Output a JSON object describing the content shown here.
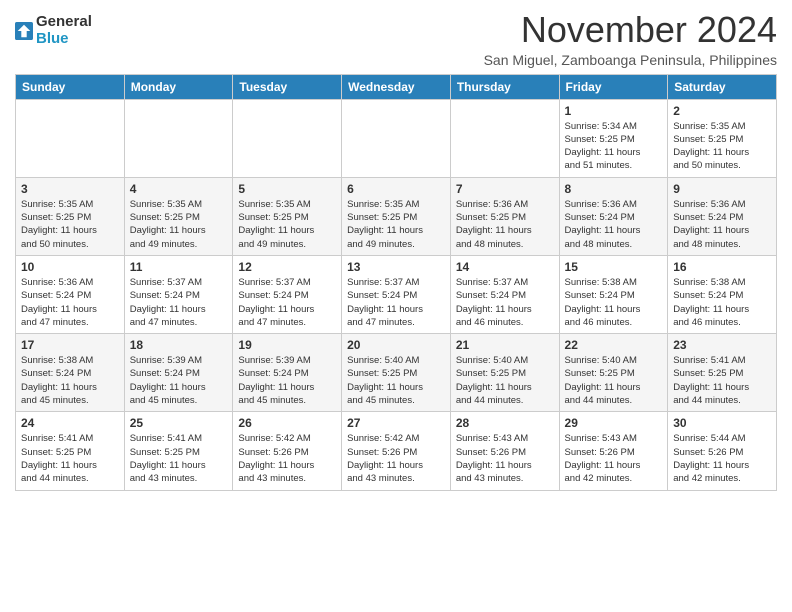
{
  "header": {
    "logo_line1": "General",
    "logo_line2": "Blue",
    "month_title": "November 2024",
    "location": "San Miguel, Zamboanga Peninsula, Philippines"
  },
  "weekdays": [
    "Sunday",
    "Monday",
    "Tuesday",
    "Wednesday",
    "Thursday",
    "Friday",
    "Saturday"
  ],
  "weeks": [
    [
      {
        "day": "",
        "info": ""
      },
      {
        "day": "",
        "info": ""
      },
      {
        "day": "",
        "info": ""
      },
      {
        "day": "",
        "info": ""
      },
      {
        "day": "",
        "info": ""
      },
      {
        "day": "1",
        "info": "Sunrise: 5:34 AM\nSunset: 5:25 PM\nDaylight: 11 hours\nand 51 minutes."
      },
      {
        "day": "2",
        "info": "Sunrise: 5:35 AM\nSunset: 5:25 PM\nDaylight: 11 hours\nand 50 minutes."
      }
    ],
    [
      {
        "day": "3",
        "info": "Sunrise: 5:35 AM\nSunset: 5:25 PM\nDaylight: 11 hours\nand 50 minutes."
      },
      {
        "day": "4",
        "info": "Sunrise: 5:35 AM\nSunset: 5:25 PM\nDaylight: 11 hours\nand 49 minutes."
      },
      {
        "day": "5",
        "info": "Sunrise: 5:35 AM\nSunset: 5:25 PM\nDaylight: 11 hours\nand 49 minutes."
      },
      {
        "day": "6",
        "info": "Sunrise: 5:35 AM\nSunset: 5:25 PM\nDaylight: 11 hours\nand 49 minutes."
      },
      {
        "day": "7",
        "info": "Sunrise: 5:36 AM\nSunset: 5:25 PM\nDaylight: 11 hours\nand 48 minutes."
      },
      {
        "day": "8",
        "info": "Sunrise: 5:36 AM\nSunset: 5:24 PM\nDaylight: 11 hours\nand 48 minutes."
      },
      {
        "day": "9",
        "info": "Sunrise: 5:36 AM\nSunset: 5:24 PM\nDaylight: 11 hours\nand 48 minutes."
      }
    ],
    [
      {
        "day": "10",
        "info": "Sunrise: 5:36 AM\nSunset: 5:24 PM\nDaylight: 11 hours\nand 47 minutes."
      },
      {
        "day": "11",
        "info": "Sunrise: 5:37 AM\nSunset: 5:24 PM\nDaylight: 11 hours\nand 47 minutes."
      },
      {
        "day": "12",
        "info": "Sunrise: 5:37 AM\nSunset: 5:24 PM\nDaylight: 11 hours\nand 47 minutes."
      },
      {
        "day": "13",
        "info": "Sunrise: 5:37 AM\nSunset: 5:24 PM\nDaylight: 11 hours\nand 47 minutes."
      },
      {
        "day": "14",
        "info": "Sunrise: 5:37 AM\nSunset: 5:24 PM\nDaylight: 11 hours\nand 46 minutes."
      },
      {
        "day": "15",
        "info": "Sunrise: 5:38 AM\nSunset: 5:24 PM\nDaylight: 11 hours\nand 46 minutes."
      },
      {
        "day": "16",
        "info": "Sunrise: 5:38 AM\nSunset: 5:24 PM\nDaylight: 11 hours\nand 46 minutes."
      }
    ],
    [
      {
        "day": "17",
        "info": "Sunrise: 5:38 AM\nSunset: 5:24 PM\nDaylight: 11 hours\nand 45 minutes."
      },
      {
        "day": "18",
        "info": "Sunrise: 5:39 AM\nSunset: 5:24 PM\nDaylight: 11 hours\nand 45 minutes."
      },
      {
        "day": "19",
        "info": "Sunrise: 5:39 AM\nSunset: 5:24 PM\nDaylight: 11 hours\nand 45 minutes."
      },
      {
        "day": "20",
        "info": "Sunrise: 5:40 AM\nSunset: 5:25 PM\nDaylight: 11 hours\nand 45 minutes."
      },
      {
        "day": "21",
        "info": "Sunrise: 5:40 AM\nSunset: 5:25 PM\nDaylight: 11 hours\nand 44 minutes."
      },
      {
        "day": "22",
        "info": "Sunrise: 5:40 AM\nSunset: 5:25 PM\nDaylight: 11 hours\nand 44 minutes."
      },
      {
        "day": "23",
        "info": "Sunrise: 5:41 AM\nSunset: 5:25 PM\nDaylight: 11 hours\nand 44 minutes."
      }
    ],
    [
      {
        "day": "24",
        "info": "Sunrise: 5:41 AM\nSunset: 5:25 PM\nDaylight: 11 hours\nand 44 minutes."
      },
      {
        "day": "25",
        "info": "Sunrise: 5:41 AM\nSunset: 5:25 PM\nDaylight: 11 hours\nand 43 minutes."
      },
      {
        "day": "26",
        "info": "Sunrise: 5:42 AM\nSunset: 5:26 PM\nDaylight: 11 hours\nand 43 minutes."
      },
      {
        "day": "27",
        "info": "Sunrise: 5:42 AM\nSunset: 5:26 PM\nDaylight: 11 hours\nand 43 minutes."
      },
      {
        "day": "28",
        "info": "Sunrise: 5:43 AM\nSunset: 5:26 PM\nDaylight: 11 hours\nand 43 minutes."
      },
      {
        "day": "29",
        "info": "Sunrise: 5:43 AM\nSunset: 5:26 PM\nDaylight: 11 hours\nand 42 minutes."
      },
      {
        "day": "30",
        "info": "Sunrise: 5:44 AM\nSunset: 5:26 PM\nDaylight: 11 hours\nand 42 minutes."
      }
    ]
  ]
}
